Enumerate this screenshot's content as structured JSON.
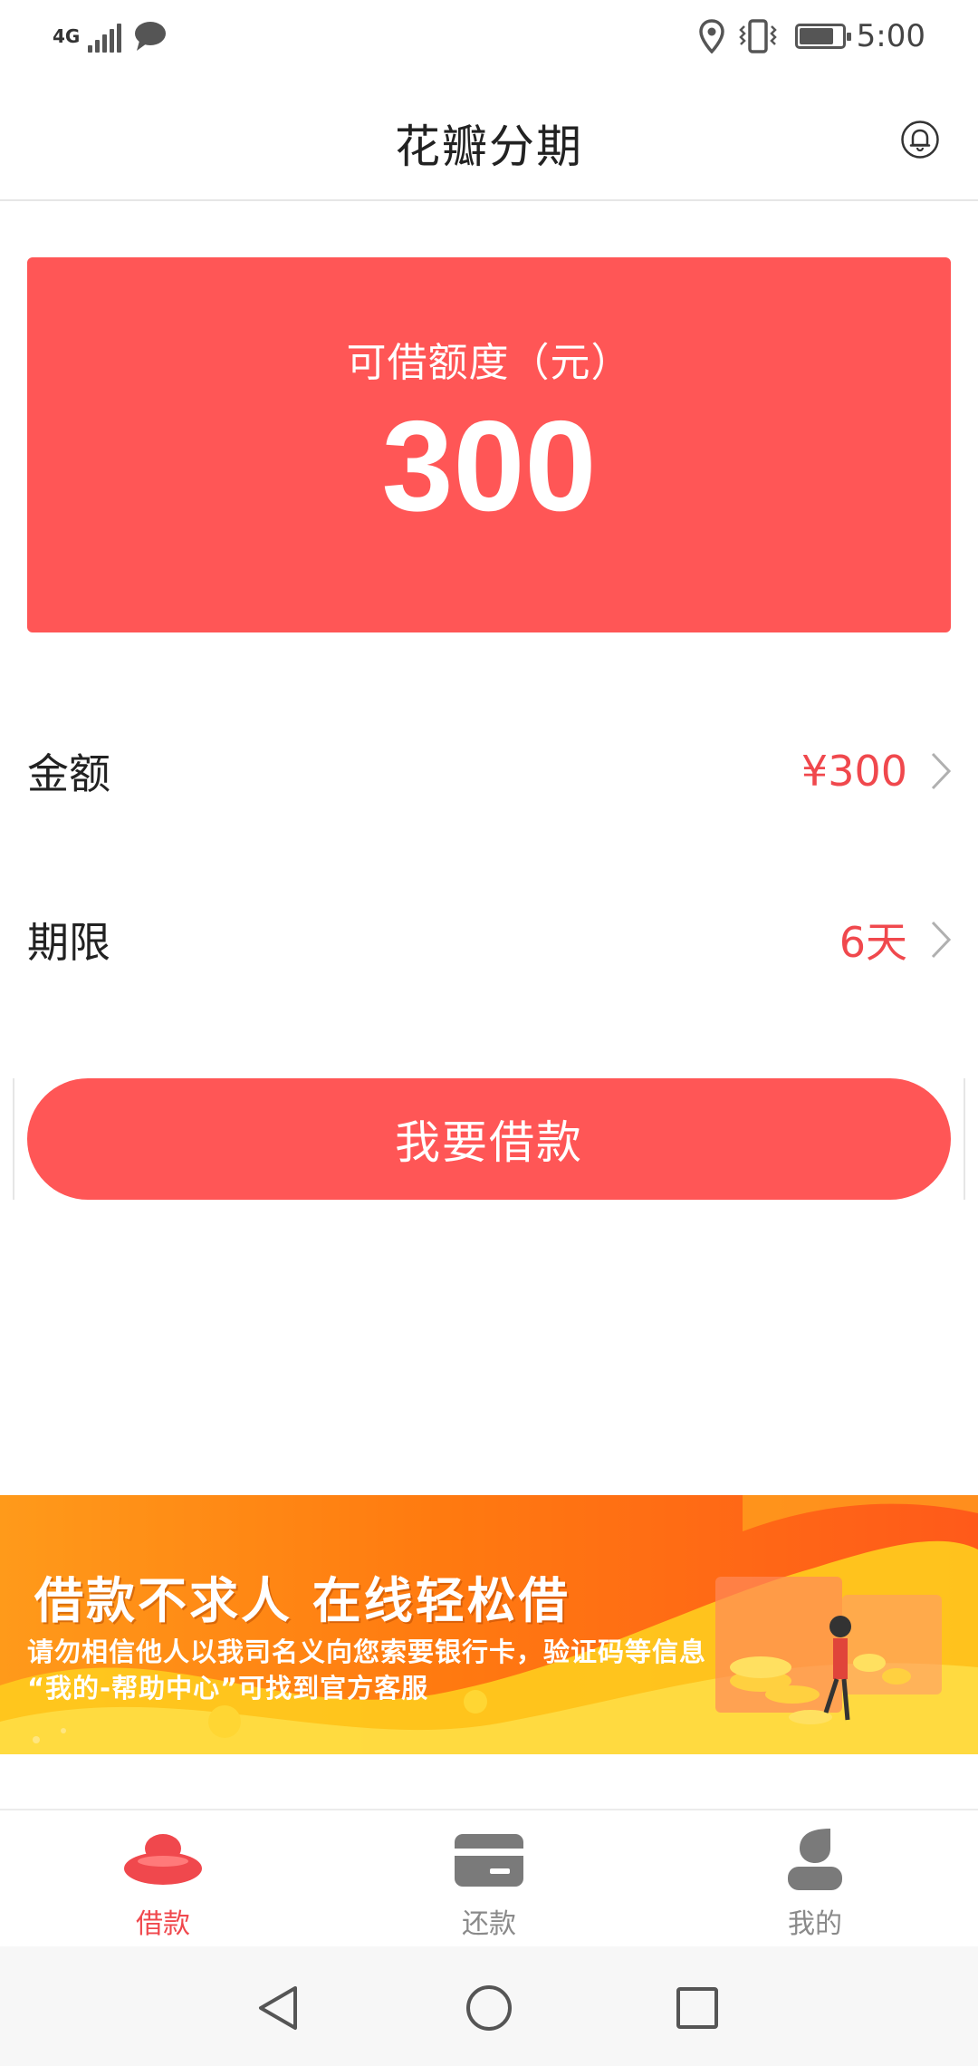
{
  "status_bar": {
    "network": "4G",
    "time": "5:00",
    "battery_level": 0.75,
    "icons": [
      "signal-icon",
      "message-icon",
      "location-icon",
      "vibrate-icon",
      "battery-icon"
    ]
  },
  "header": {
    "title": "花瓣分期",
    "icon": "bell-icon"
  },
  "credit": {
    "label": "可借额度（元）",
    "amount": "300"
  },
  "loan_form": {
    "amount_label": "金额",
    "amount_value": "¥300",
    "term_label": "期限",
    "term_value": "6天"
  },
  "borrow_button": {
    "label": "我要借款"
  },
  "banner": {
    "title": "借款不求人 在线轻松借",
    "line1": "请勿相信他人以我司名义向您索要银行卡，验证码等信息",
    "line2": "“我的-帮助中心”可找到官方客服"
  },
  "tabs": [
    {
      "label": "借款",
      "icon": "ingot-icon",
      "active": true
    },
    {
      "label": "还款",
      "icon": "card-icon",
      "active": false
    },
    {
      "label": "我的",
      "icon": "user-icon",
      "active": false
    }
  ],
  "colors": {
    "accent": "#ff5656",
    "accent_text": "#f0484d",
    "banner_orange": "#ff7a10",
    "inactive": "#8a8a8a"
  }
}
